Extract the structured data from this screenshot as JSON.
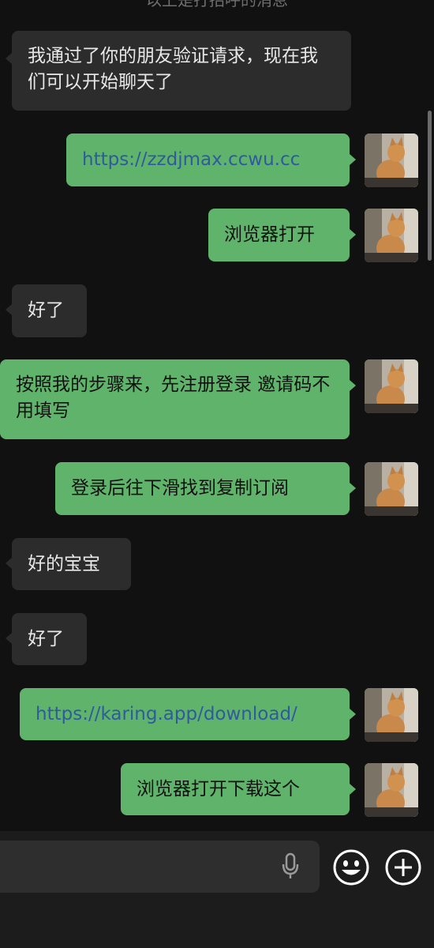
{
  "top_hint": "以上是打招呼的消息",
  "messages": [
    {
      "side": "incoming",
      "text": "我通过了你的朋友验证请求，现在我们可以开始聊天了"
    },
    {
      "side": "outgoing",
      "text": "https://zzdjmax.ccwu.cc",
      "is_link": true
    },
    {
      "side": "outgoing",
      "text": "浏览器打开"
    },
    {
      "side": "incoming",
      "text": "好了"
    },
    {
      "side": "outgoing",
      "text": "按照我的步骤来，先注册登录  邀请码不用填写"
    },
    {
      "side": "outgoing",
      "text": "登录后往下滑找到复制订阅"
    },
    {
      "side": "incoming",
      "text": "好的宝宝"
    },
    {
      "side": "incoming",
      "text": "好了"
    },
    {
      "side": "outgoing",
      "text": "https://karing.app/download/",
      "is_link": true
    },
    {
      "side": "outgoing",
      "text": "浏览器打开下载这个"
    }
  ],
  "input_bar": {
    "mic_icon": "microphone-icon",
    "emoji_icon": "emoji-smiley-icon",
    "add_icon": "plus-circle-icon"
  },
  "colors": {
    "background": "#111111",
    "incoming_bubble": "#2c2c2c",
    "outgoing_bubble": "#5fb36a",
    "link_text": "#2f5b9e"
  }
}
